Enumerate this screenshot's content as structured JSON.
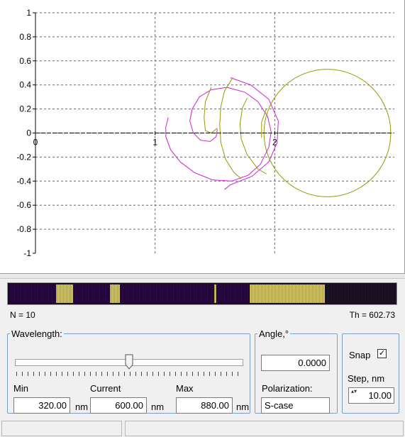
{
  "chart_data": {
    "type": "line",
    "x_axis": {
      "min": 0,
      "max": 3,
      "tick_values": [
        0,
        1,
        2
      ],
      "tick_labels": [
        "0",
        "1",
        "2"
      ]
    },
    "y_axis": {
      "min": -1,
      "max": 1,
      "tick_values": [
        1,
        0.8,
        0.6,
        0.4,
        0.2,
        0,
        -0.2,
        -0.4,
        -0.6,
        -0.8,
        -1
      ],
      "tick_labels": [
        "1",
        "0.8",
        "0.6",
        "0.4",
        "0.2",
        "0",
        "-0.2",
        "-0.4",
        "-0.6",
        "-0.8",
        "-1"
      ]
    },
    "grid": true,
    "series": [
      {
        "color": "#d020d0",
        "points": [
          [
            1.11,
            0.13
          ],
          [
            1.09,
            0.05
          ],
          [
            1.09,
            -0.03
          ],
          [
            1.13,
            -0.14
          ],
          [
            1.21,
            -0.24
          ],
          [
            1.33,
            -0.33
          ],
          [
            1.48,
            -0.39
          ],
          [
            1.64,
            -0.4
          ],
          [
            1.78,
            -0.35
          ],
          [
            1.88,
            -0.26
          ],
          [
            1.95,
            -0.12
          ],
          [
            1.97,
            0.01
          ],
          [
            1.94,
            0.14
          ],
          [
            1.86,
            0.26
          ],
          [
            1.75,
            0.34
          ],
          [
            1.6,
            0.38
          ],
          [
            1.47,
            0.36
          ],
          [
            1.37,
            0.3
          ],
          [
            1.31,
            0.2
          ],
          [
            1.29,
            0.1
          ],
          [
            1.32,
            0.0
          ],
          [
            1.38,
            -0.06
          ],
          [
            1.46,
            -0.07
          ],
          [
            1.51,
            -0.03
          ],
          [
            1.52,
            0.03
          ]
        ]
      },
      {
        "color": "#d020d0",
        "points": [
          [
            1.63,
            0.46
          ],
          [
            1.8,
            0.4
          ],
          [
            1.95,
            0.28
          ],
          [
            2.03,
            0.1
          ],
          [
            2.02,
            -0.08
          ],
          [
            1.95,
            -0.24
          ],
          [
            1.81,
            -0.36
          ],
          [
            1.63,
            -0.43
          ],
          [
            1.58,
            -0.47
          ]
        ]
      },
      {
        "color": "#989800",
        "points": [
          [
            1.47,
            0.38
          ],
          [
            1.42,
            0.26
          ],
          [
            1.41,
            0.13
          ],
          [
            1.42,
            0.02
          ],
          [
            1.47,
            0.0
          ],
          [
            1.52,
            0.04
          ]
        ]
      },
      {
        "color": "#989800",
        "points": [
          [
            1.65,
            0.46
          ],
          [
            1.58,
            0.35
          ],
          [
            1.55,
            0.22
          ],
          [
            1.54,
            0.07
          ],
          [
            1.55,
            -0.08
          ],
          [
            1.59,
            -0.22
          ],
          [
            1.66,
            -0.33
          ],
          [
            1.72,
            -0.38
          ]
        ]
      },
      {
        "color": "#989800",
        "points": [
          [
            1.77,
            0.29
          ],
          [
            1.73,
            0.21
          ],
          [
            1.71,
            0.08
          ],
          [
            1.72,
            -0.05
          ],
          [
            1.77,
            -0.18
          ],
          [
            1.86,
            -0.3
          ],
          [
            1.93,
            -0.34
          ]
        ]
      },
      {
        "color": "#989800",
        "points": [
          [
            1.93,
            0.2
          ],
          [
            1.89,
            0.09
          ],
          [
            1.89,
            -0.04
          ]
        ]
      },
      {
        "color": "#989800",
        "circle": {
          "cx": 2.44,
          "cy": 0.0,
          "r": 0.53
        }
      },
      {
        "color": "#000000",
        "dashed": true,
        "points": [
          [
            0,
            0
          ],
          [
            2.99,
            0
          ]
        ]
      }
    ]
  },
  "status": {
    "n_text": "N = 10",
    "th_text": "Th = 602.73"
  },
  "stripe": [
    {
      "kind": "dark",
      "from": 0.0,
      "to": 0.12
    },
    {
      "kind": "light",
      "from": 0.12,
      "to": 0.165
    },
    {
      "kind": "dark",
      "from": 0.165,
      "to": 0.26
    },
    {
      "kind": "light",
      "from": 0.26,
      "to": 0.285
    },
    {
      "kind": "dark",
      "from": 0.285,
      "to": 0.53
    },
    {
      "kind": "light",
      "from": 0.53,
      "to": 0.535
    },
    {
      "kind": "dark",
      "from": 0.535,
      "to": 0.62
    },
    {
      "kind": "light",
      "from": 0.62,
      "to": 0.815
    },
    {
      "kind": "dark",
      "from": 0.815,
      "to": 1.0
    }
  ],
  "wavelength": {
    "title": "Wavelength:",
    "slider_fraction": 0.5,
    "min_label": "Min",
    "current_label": "Current",
    "max_label": "Max",
    "min_value": "320.00",
    "current_value": "600.00",
    "max_value": "880.00",
    "unit": "nm"
  },
  "angle": {
    "title": "Angle,°",
    "value": "0.0000",
    "polarization_label": "Polarization:",
    "polarization_value": "S-case"
  },
  "snap": {
    "label": "Snap",
    "checked": true,
    "check_glyph": "✓",
    "step_label": "Step, nm",
    "step_value": "10.00",
    "spin_glyph": "▴▾"
  }
}
